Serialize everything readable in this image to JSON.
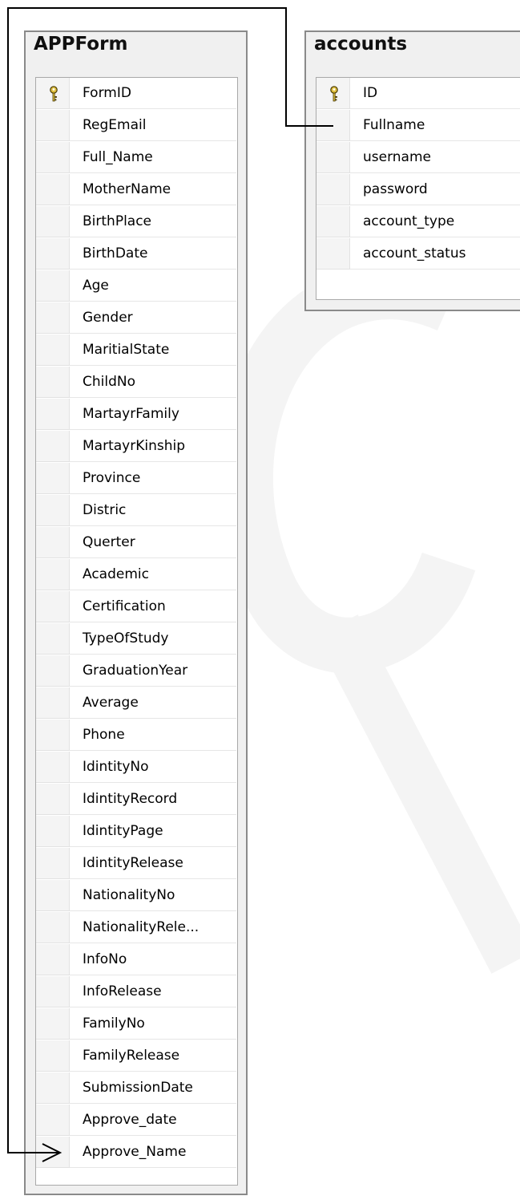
{
  "diagram": {
    "tables": [
      {
        "name": "APPForm",
        "columns": [
          {
            "name": "FormID",
            "primary_key": true
          },
          {
            "name": "RegEmail"
          },
          {
            "name": "Full_Name"
          },
          {
            "name": "MotherName"
          },
          {
            "name": "BirthPlace"
          },
          {
            "name": "BirthDate"
          },
          {
            "name": "Age"
          },
          {
            "name": "Gender"
          },
          {
            "name": "MaritialState"
          },
          {
            "name": "ChildNo"
          },
          {
            "name": "MartayrFamily"
          },
          {
            "name": "MartayrKinship"
          },
          {
            "name": "Province"
          },
          {
            "name": "Distric"
          },
          {
            "name": "Querter"
          },
          {
            "name": "Academic"
          },
          {
            "name": "Certification"
          },
          {
            "name": "TypeOfStudy"
          },
          {
            "name": "GraduationYear"
          },
          {
            "name": "Average"
          },
          {
            "name": "Phone"
          },
          {
            "name": "IdintityNo"
          },
          {
            "name": "IdintityRecord"
          },
          {
            "name": "IdintityPage"
          },
          {
            "name": "IdintityRelease"
          },
          {
            "name": "NationalityNo"
          },
          {
            "name": "NationalityRele..."
          },
          {
            "name": "InfoNo"
          },
          {
            "name": "InfoRelease"
          },
          {
            "name": "FamilyNo"
          },
          {
            "name": "FamilyRelease"
          },
          {
            "name": "SubmissionDate"
          },
          {
            "name": "Approve_date"
          },
          {
            "name": "Approve_Name"
          }
        ]
      },
      {
        "name": "accounts",
        "columns": [
          {
            "name": "ID",
            "primary_key": true
          },
          {
            "name": "Fullname"
          },
          {
            "name": "username"
          },
          {
            "name": "password"
          },
          {
            "name": "account_type"
          },
          {
            "name": "account_status"
          }
        ]
      }
    ],
    "relationship": {
      "from_table": "accounts",
      "from_column": "Fullname",
      "to_table": "APPForm",
      "to_column": "Approve_Name",
      "arrow": "to"
    },
    "colors": {
      "box_fill": "#f0f0f0",
      "box_border": "#8a8a8a",
      "grid_fill": "#ffffff",
      "key_icon": "#e0c040",
      "line": "#000000"
    },
    "icons": [
      "key-icon"
    ]
  }
}
